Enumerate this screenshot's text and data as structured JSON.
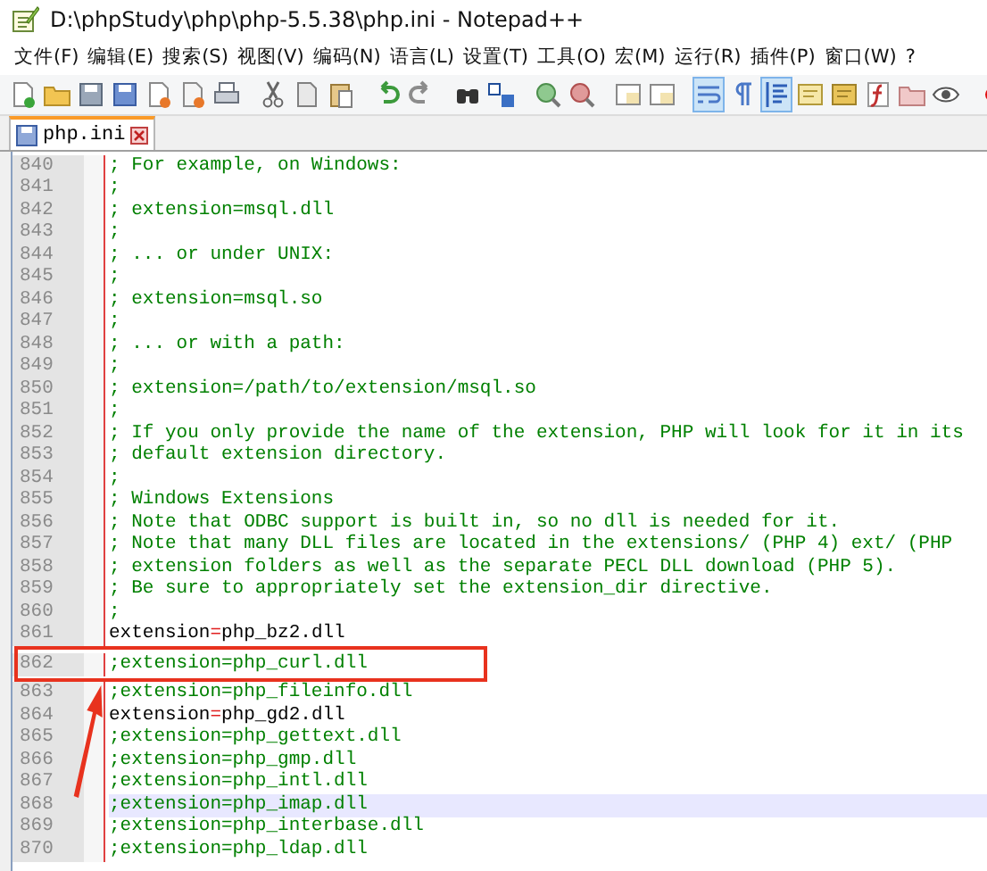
{
  "window": {
    "title": "D:\\phpStudy\\php\\php-5.5.38\\php.ini - Notepad++"
  },
  "menu": [
    "文件(F)",
    "编辑(E)",
    "搜索(S)",
    "视图(V)",
    "编码(N)",
    "语言(L)",
    "设置(T)",
    "工具(O)",
    "宏(M)",
    "运行(R)",
    "插件(P)",
    "窗口(W)",
    "?"
  ],
  "toolbar": [
    {
      "kind": "new",
      "pressed": false
    },
    {
      "kind": "open",
      "pressed": false
    },
    {
      "kind": "save",
      "pressed": false
    },
    {
      "kind": "saveall",
      "pressed": false
    },
    {
      "kind": "close",
      "pressed": false
    },
    {
      "kind": "closeall",
      "pressed": false
    },
    {
      "kind": "print",
      "pressed": false
    },
    {
      "kind": "sep"
    },
    {
      "kind": "cut",
      "pressed": false
    },
    {
      "kind": "copy",
      "pressed": false
    },
    {
      "kind": "paste",
      "pressed": false
    },
    {
      "kind": "sep"
    },
    {
      "kind": "undo",
      "pressed": false
    },
    {
      "kind": "redo",
      "pressed": false
    },
    {
      "kind": "sep"
    },
    {
      "kind": "find",
      "pressed": false
    },
    {
      "kind": "replace",
      "pressed": false
    },
    {
      "kind": "sep"
    },
    {
      "kind": "zoomin",
      "pressed": false
    },
    {
      "kind": "zoomout",
      "pressed": false
    },
    {
      "kind": "sep"
    },
    {
      "kind": "syncv",
      "pressed": false
    },
    {
      "kind": "synch",
      "pressed": false
    },
    {
      "kind": "sep"
    },
    {
      "kind": "wrap",
      "pressed": true
    },
    {
      "kind": "pilcrow",
      "pressed": false
    },
    {
      "kind": "indent",
      "pressed": true
    },
    {
      "kind": "udl",
      "pressed": false
    },
    {
      "kind": "map",
      "pressed": false
    },
    {
      "kind": "func",
      "pressed": false
    },
    {
      "kind": "folder",
      "pressed": false
    },
    {
      "kind": "eye",
      "pressed": false
    },
    {
      "kind": "sep"
    },
    {
      "kind": "record",
      "pressed": false
    }
  ],
  "tabs": [
    {
      "label": "php.ini",
      "selected": true
    }
  ],
  "lines": [
    {
      "number": "840",
      "kind": "comment",
      "text": "; For example, on Windows:",
      "current": false,
      "marked": false
    },
    {
      "number": "841",
      "kind": "comment",
      "text": ";",
      "current": false,
      "marked": false
    },
    {
      "number": "842",
      "kind": "comment",
      "text": ";   extension=msql.dll",
      "current": false,
      "marked": false
    },
    {
      "number": "843",
      "kind": "comment",
      "text": ";",
      "current": false,
      "marked": false
    },
    {
      "number": "844",
      "kind": "comment",
      "text": "; ... or under UNIX:",
      "current": false,
      "marked": false
    },
    {
      "number": "845",
      "kind": "comment",
      "text": ";",
      "current": false,
      "marked": false
    },
    {
      "number": "846",
      "kind": "comment",
      "text": ";   extension=msql.so",
      "current": false,
      "marked": false
    },
    {
      "number": "847",
      "kind": "comment",
      "text": ";",
      "current": false,
      "marked": false
    },
    {
      "number": "848",
      "kind": "comment",
      "text": "; ... or with a path:",
      "current": false,
      "marked": false
    },
    {
      "number": "849",
      "kind": "comment",
      "text": ";",
      "current": false,
      "marked": false
    },
    {
      "number": "850",
      "kind": "comment",
      "text": ";   extension=/path/to/extension/msql.so",
      "current": false,
      "marked": false
    },
    {
      "number": "851",
      "kind": "comment",
      "text": ";",
      "current": false,
      "marked": false
    },
    {
      "number": "852",
      "kind": "comment",
      "text": "; If you only provide the name of the extension, PHP will look for it in its",
      "current": false,
      "marked": false
    },
    {
      "number": "853",
      "kind": "comment",
      "text": "; default extension directory.",
      "current": false,
      "marked": false
    },
    {
      "number": "854",
      "kind": "comment",
      "text": ";",
      "current": false,
      "marked": false
    },
    {
      "number": "855",
      "kind": "comment",
      "text": "; Windows Extensions",
      "current": false,
      "marked": false
    },
    {
      "number": "856",
      "kind": "comment",
      "text": "; Note that ODBC support is built in, so no dll is needed for it.",
      "current": false,
      "marked": false
    },
    {
      "number": "857",
      "kind": "comment",
      "text": "; Note that many DLL files are located in the extensions/ (PHP 4) ext/ (PHP",
      "current": false,
      "marked": false
    },
    {
      "number": "858",
      "kind": "comment",
      "text": "; extension folders as well as the separate PECL DLL download (PHP 5).",
      "current": false,
      "marked": false
    },
    {
      "number": "859",
      "kind": "comment",
      "text": "; Be sure to appropriately set the extension_dir directive.",
      "current": false,
      "marked": false
    },
    {
      "number": "860",
      "kind": "comment",
      "text": ";",
      "current": false,
      "marked": false
    },
    {
      "number": "861",
      "kind": "directive",
      "text": "extension=php_bz2.dll",
      "current": false,
      "marked": false
    },
    {
      "number": "862",
      "kind": "comment",
      "text": ";extension=php_curl.dll",
      "current": false,
      "marked": true
    },
    {
      "number": "863",
      "kind": "comment",
      "text": ";extension=php_fileinfo.dll",
      "current": false,
      "marked": false
    },
    {
      "number": "864",
      "kind": "directive",
      "text": "extension=php_gd2.dll",
      "current": false,
      "marked": false
    },
    {
      "number": "865",
      "kind": "comment",
      "text": ";extension=php_gettext.dll",
      "current": false,
      "marked": false
    },
    {
      "number": "866",
      "kind": "comment",
      "text": ";extension=php_gmp.dll",
      "current": false,
      "marked": false
    },
    {
      "number": "867",
      "kind": "comment",
      "text": ";extension=php_intl.dll",
      "current": false,
      "marked": false
    },
    {
      "number": "868",
      "kind": "comment",
      "text": ";extension=php_imap.dll",
      "current": true,
      "marked": false
    },
    {
      "number": "869",
      "kind": "comment",
      "text": ";extension=php_interbase.dll",
      "current": false,
      "marked": false
    },
    {
      "number": "870",
      "kind": "comment",
      "text": ";extension=php_ldap.dll",
      "current": false,
      "marked": false
    }
  ]
}
